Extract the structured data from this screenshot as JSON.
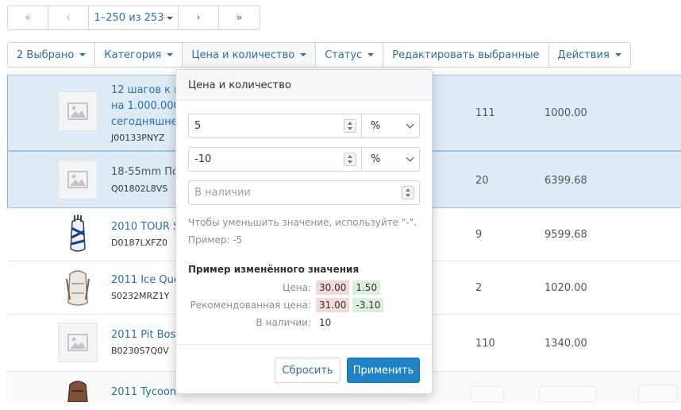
{
  "pagination": {
    "first_icon": "«",
    "prev_icon": "‹",
    "range": "1–250 из 253",
    "next_icon": "›",
    "last_icon": "»"
  },
  "toolbar": {
    "selected": "2 Выбрано",
    "category": "Категория",
    "price_qty": "Цена и количество",
    "status": "Статус",
    "edit_selected": "Редактировать выбранные",
    "actions": "Действия"
  },
  "products": [
    {
      "name_lines": [
        "12 шагов к по",
        "на 1.000.000$",
        "сегодняшнего"
      ],
      "code": "J00133PNYZ",
      "qty": "111",
      "price": "1000.00",
      "image": "placeholder-icon",
      "selected": true
    },
    {
      "name_lines": [
        "18-55mm Пор"
      ],
      "code": "Q01802L8VS",
      "qty": "20",
      "price": "6399.68",
      "image": "placeholder-icon",
      "selected": true
    },
    {
      "name_lines": [
        "2010 TOUR ST"
      ],
      "code": "D0187LXFZ0",
      "qty": "9",
      "price": "9599.68",
      "image": "golf-bag-image",
      "selected": false
    },
    {
      "name_lines": [
        "2011 Ice Quee"
      ],
      "code": "S0232MRZ1Y",
      "qty": "2",
      "price": "1020.00",
      "image": "backpack-image",
      "selected": false
    },
    {
      "name_lines": [
        "2011 Pit Boss"
      ],
      "code": "B0230S7Q0V",
      "qty": "110",
      "price": "1340.00",
      "image": "placeholder-icon",
      "selected": false
    },
    {
      "name_lines": [
        "2011 Tycoon"
      ],
      "code": "",
      "qty": "",
      "price": "",
      "image": "backpack-image",
      "selected": false
    }
  ],
  "popup": {
    "title": "Цена и количество",
    "price_value": "5",
    "price_unit": "%",
    "list_price_value": "-10",
    "list_price_unit": "%",
    "stock_placeholder": "В наличии",
    "hint_line1": "Чтобы уменьшить значение, используйте \"-\".",
    "hint_line2": "Пример: -5",
    "example_title": "Пример изменённого значения",
    "example_rows": [
      {
        "label": "Цена:",
        "old": "30.00",
        "new": "1.50"
      },
      {
        "label": "Рекомендованная цена:",
        "old": "31.00",
        "new": "-3.10"
      },
      {
        "label": "В наличии:",
        "value": "10"
      }
    ],
    "reset_label": "Сбросить",
    "apply_label": "Применить",
    "colors": {
      "apply": "#1f82c4",
      "old_value_bg": "#f5d9d9",
      "new_value_bg": "#dcefdc"
    }
  }
}
